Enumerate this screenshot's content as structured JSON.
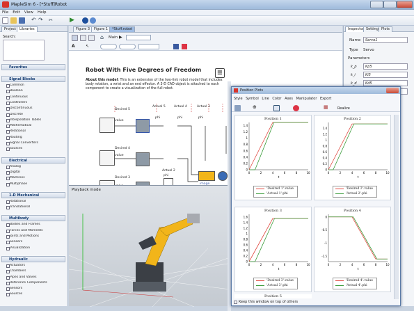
{
  "window": {
    "title": "MapleSim 6 - [*Stuff]Robot"
  },
  "menu": [
    "File",
    "Edit",
    "View",
    "Help"
  ],
  "left": {
    "tabs": [
      "Project",
      "Libraries"
    ],
    "search_label": "Search:",
    "groups": [
      {
        "name": "Favorites",
        "items": []
      },
      {
        "name": "Signal Blocks",
        "items": [
          "Common",
          "Boolean",
          "Continuous",
          "Controllers",
          "Discontinuous",
          "Discrete",
          "Interpolation Tables",
          "Mathematical",
          "Relational",
          "Routing",
          "Signal Converters",
          "Sources"
        ]
      },
      {
        "name": "Electrical",
        "items": [
          "Analog",
          "Digital",
          "Machines",
          "Multiphase"
        ]
      },
      {
        "name": "1-D Mechanical",
        "items": [
          "Rotational",
          "Translational"
        ]
      },
      {
        "name": "Multibody",
        "items": [
          "Bodies and Frames",
          "Forces and Moments",
          "Joints and Motions",
          "Sensors",
          "Visualization"
        ]
      },
      {
        "name": "Hydraulic",
        "items": [
          "Actuators",
          "Chambers",
          "Pipes and Valves",
          "Reference Components",
          "Sensors",
          "Sources"
        ]
      }
    ]
  },
  "doc_tabs": [
    "Figure 3",
    "Figure 1",
    "*Stuff.robot"
  ],
  "model_toolbar": {
    "main": "Main"
  },
  "doc": {
    "title": "Robot With Five Degrees of Freedom",
    "about_label": "About this model",
    "about_text": ": This is an extension of the two-link robot model that includes body rotation, a wrist and an end effector. A 3-D CAD object is attached to each component to create a visualization of the full robot."
  },
  "diagram": {
    "labels": [
      "Desired 5",
      "Desired 4",
      "Desired 3",
      "value",
      "value",
      "value",
      "Actual 5",
      "Actual 4",
      "Actual 3",
      "phi",
      "phi",
      "phi",
      "Actual 2",
      "phi",
      "image"
    ]
  },
  "playback": {
    "label": "Playback mode"
  },
  "right": {
    "tabs": [
      "Inspector",
      "Settings",
      "Plots"
    ],
    "name_label": "Name",
    "name_value": "Servo1",
    "type_label": "Type",
    "type_value": "Servo",
    "section": "Parameters",
    "params": [
      {
        "k": "k_p",
        "v": "Kp5"
      },
      {
        "k": "k_i",
        "v": "Ki5"
      },
      {
        "k": "k_d",
        "v": "Kd5"
      },
      {
        "k": "x0",
        "v": "..."
      }
    ]
  },
  "plots": {
    "title": "Position Plots",
    "menu": [
      "Style",
      "Symbol",
      "Line",
      "Color",
      "Axes",
      "Manipulator",
      "Export"
    ],
    "realize": "Realize",
    "keep_label": "Keep this window on top of others",
    "xlabel": "t",
    "cells": [
      {
        "title": "Position 1",
        "legend": [
          "'Desired 1'.value",
          "'Actual 1'.phi"
        ],
        "yticks": [
          "0",
          "0.2",
          "0.4",
          "0.6",
          "0.8",
          "1",
          "1.2",
          "1.4"
        ],
        "xticks": [
          "0",
          "2",
          "4",
          "6",
          "8",
          "10"
        ]
      },
      {
        "title": "Position 2",
        "legend": [
          "'Desired 2'.value",
          "'Actual 2'.phi"
        ],
        "yticks": [
          "0",
          "0.2",
          "0.4",
          "0.6",
          "0.8",
          "1",
          "1.2",
          "1.4"
        ],
        "xticks": [
          "0",
          "2",
          "4",
          "6",
          "8",
          "10"
        ]
      },
      {
        "title": "Position 3",
        "legend": [
          "'Desired 3'.value",
          "'Actual 3'.phi"
        ],
        "yticks": [
          "0",
          "0.2",
          "0.4",
          "0.6",
          "0.8",
          "1",
          "1.2",
          "1.4",
          "1.6"
        ],
        "xticks": [
          "0",
          "2",
          "4",
          "6",
          "8",
          "10"
        ]
      },
      {
        "title": "Position 4",
        "legend": [
          "'Desired 4'.value",
          "'Actual 4'.phi"
        ],
        "yticks": [
          "0",
          "-0.5",
          "-1",
          "-1.5"
        ],
        "xticks": [
          "0",
          "2",
          "4",
          "6",
          "8",
          "10"
        ]
      }
    ],
    "bottom_title": "Position 5"
  },
  "colors": {
    "desired": "#e0483f",
    "actual": "#3a9c3a",
    "robot": "#f2b51a"
  }
}
